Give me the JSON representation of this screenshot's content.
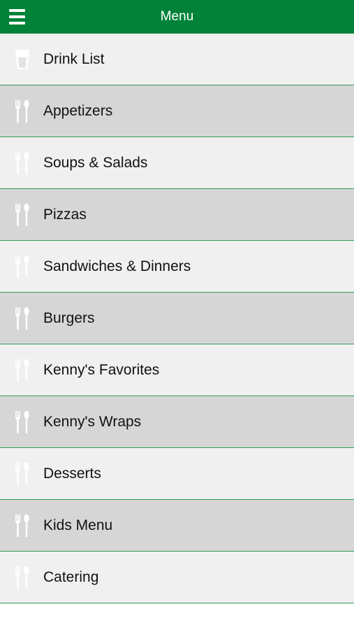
{
  "header": {
    "title": "Menu",
    "menu_icon": "hamburger-icon",
    "background_color": "#018239"
  },
  "list": {
    "items": [
      {
        "label": "Drink List",
        "icon": "drink-cup-icon"
      },
      {
        "label": "Appetizers",
        "icon": "fork-spoon-icon"
      },
      {
        "label": "Soups & Salads",
        "icon": "fork-spoon-icon"
      },
      {
        "label": "Pizzas",
        "icon": "fork-spoon-icon"
      },
      {
        "label": "Sandwiches & Dinners",
        "icon": "fork-spoon-icon"
      },
      {
        "label": "Burgers",
        "icon": "fork-spoon-icon"
      },
      {
        "label": "Kenny's Favorites",
        "icon": "fork-spoon-icon"
      },
      {
        "label": "Kenny's Wraps",
        "icon": "fork-spoon-icon"
      },
      {
        "label": "Desserts",
        "icon": "fork-spoon-icon"
      },
      {
        "label": "Kids Menu",
        "icon": "fork-spoon-icon"
      },
      {
        "label": "Catering",
        "icon": "fork-spoon-icon"
      }
    ],
    "row_light_color": "#f0f0f0",
    "row_dark_color": "#d6d6d6",
    "divider_color": "#2e9a57"
  }
}
